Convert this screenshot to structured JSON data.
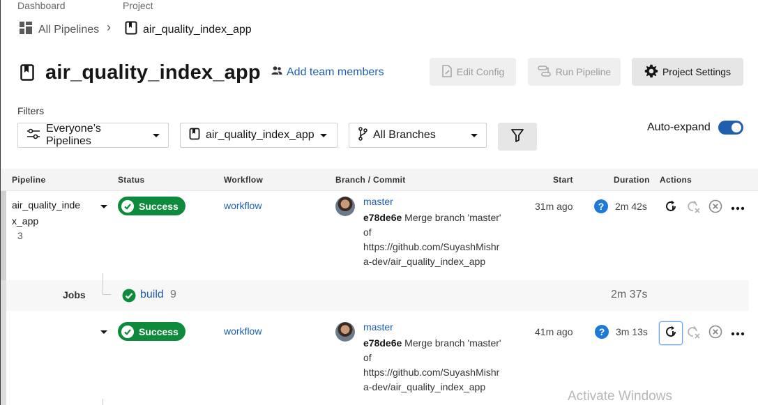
{
  "breadcrumb": {
    "dashboard_label": "Dashboard",
    "project_label": "Project",
    "all_pipelines": "All Pipelines",
    "separator": "›",
    "current_project": "air_quality_index_app"
  },
  "header": {
    "title": "air_quality_index_app",
    "add_team": "Add team members",
    "edit_config": "Edit Config",
    "run_pipeline": "Run Pipeline",
    "project_settings": "Project Settings"
  },
  "filters": {
    "label": "Filters",
    "pipelines_dropdown": "Everyone’s Pipelines",
    "project_dropdown": "air_quality_index_app",
    "branches_dropdown": "All Branches",
    "auto_expand": "Auto-expand",
    "auto_expand_on": true
  },
  "table": {
    "headers": {
      "pipeline": "Pipeline",
      "status": "Status",
      "workflow": "Workflow",
      "branch_commit": "Branch / Commit",
      "start": "Start",
      "duration": "Duration",
      "actions": "Actions"
    },
    "rows": [
      {
        "pipeline_name_line1": "air_quality_inde",
        "pipeline_name_line2": "x_app",
        "pipeline_number": "3",
        "status": "Success",
        "workflow": "workflow",
        "branch": "master",
        "commit_hash": "e78de6e",
        "commit_msg_line1": "Merge branch 'master'",
        "commit_msg_line2": "of",
        "commit_msg_line3": "https://github.com/SuyashMishr",
        "commit_msg_line4": "a-dev/air_quality_index_app",
        "start": "31m ago",
        "duration": "2m 42s"
      },
      {
        "status": "Success",
        "workflow": "workflow",
        "branch": "master",
        "commit_hash": "e78de6e",
        "commit_msg_line1": "Merge branch 'master'",
        "commit_msg_line2": "of",
        "commit_msg_line3": "https://github.com/SuyashMishr",
        "commit_msg_line4": "a-dev/air_quality_index_app",
        "start": "41m ago",
        "duration": "3m 13s"
      }
    ],
    "jobs": {
      "label": "Jobs",
      "job_name": "build",
      "job_number": "9",
      "job_duration": "2m 37s"
    }
  },
  "watermark": "Activate Windows",
  "colors": {
    "success": "#0e8a3c",
    "link": "#1f5fae",
    "help": "#1f7ad6"
  }
}
